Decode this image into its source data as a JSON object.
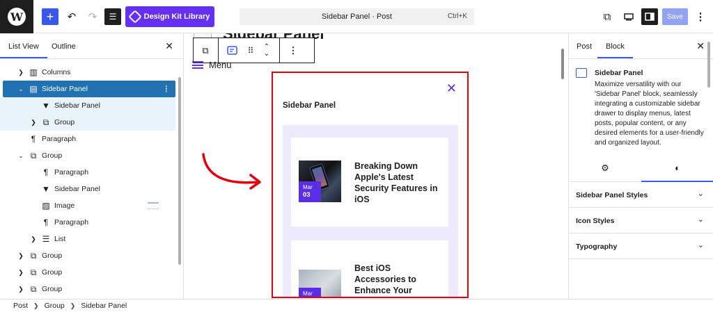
{
  "topbar": {
    "logo_letter": "W",
    "add_icon": "plus-icon",
    "undo_icon": "undo-icon",
    "redo_icon": "redo-icon",
    "document_overview_icon": "list-view-icon",
    "design_kit_label": "Design Kit Library",
    "command_title": "Sidebar Panel · Post",
    "command_shortcut": "Ctrl+K",
    "view_icon": "external-link-icon",
    "preview_icon": "desktop-icon",
    "settings_icon": "sidebar-toggle-icon",
    "save_label": "Save",
    "more_icon": "kebab-icon"
  },
  "left_panel": {
    "tabs": [
      "List View",
      "Outline"
    ],
    "active_tab": "List View",
    "tree": [
      {
        "label": "Columns",
        "icon": "columns-icon",
        "chevron": "›",
        "selected": false
      },
      {
        "label": "Sidebar Panel",
        "icon": "sidebar-panel-icon",
        "chevron": "⌄",
        "selected": true
      },
      {
        "label": "Sidebar Panel",
        "icon": "bookmark-icon",
        "chevron": "",
        "selected": false
      },
      {
        "label": "Group",
        "icon": "group-icon",
        "chevron": "›",
        "selected": false
      },
      {
        "label": "Paragraph",
        "icon": "paragraph-icon",
        "chevron": "",
        "selected": false
      },
      {
        "label": "Group",
        "icon": "group-icon",
        "chevron": "⌄",
        "selected": false
      },
      {
        "label": "Paragraph",
        "icon": "paragraph-icon",
        "chevron": "",
        "selected": false
      },
      {
        "label": "Sidebar Panel",
        "icon": "bookmark-icon",
        "chevron": "",
        "selected": false
      },
      {
        "label": "Image",
        "icon": "image-icon",
        "chevron": "",
        "selected": false
      },
      {
        "label": "Paragraph",
        "icon": "paragraph-icon",
        "chevron": "",
        "selected": false
      },
      {
        "label": "List",
        "icon": "list-icon",
        "chevron": "›",
        "selected": false
      },
      {
        "label": "Group",
        "icon": "group-icon",
        "chevron": "›",
        "selected": false
      },
      {
        "label": "Group",
        "icon": "group-icon",
        "chevron": "›",
        "selected": false
      },
      {
        "label": "Group",
        "icon": "group-icon",
        "chevron": "›",
        "selected": false
      }
    ]
  },
  "canvas": {
    "page_title": "Sidebar Panel",
    "menu_label": "Menu",
    "panel_title": "Sidebar Panel",
    "posts": [
      {
        "title": "Breaking Down Apple's Latest Security Features in iOS",
        "month": "Mar",
        "day": "03"
      },
      {
        "title": "Best iOS Accessories to Enhance Your",
        "month": "Mar",
        "day": ""
      }
    ]
  },
  "right_panel": {
    "tabs": [
      "Post",
      "Block"
    ],
    "active_tab": "Block",
    "block_name": "Sidebar Panel",
    "block_description": "Maximize versatility with our 'Sidebar Panel' block, seamlessly integrating a customizable sidebar drawer to display menus, latest posts, popular content, or any desired elements for a user-friendly and organized layout.",
    "icon_tabs": [
      "settings-icon",
      "styles-icon"
    ],
    "sections": [
      "Sidebar Panel Styles",
      "Icon Styles",
      "Typography"
    ]
  },
  "footer": {
    "breadcrumbs": [
      "Post",
      "Group",
      "Sidebar Panel"
    ]
  },
  "colors": {
    "accent": "#3858e9",
    "brand_purple": "#6530f5",
    "selection": "#2271b1",
    "highlight_frame": "#e3000f",
    "panel_bg": "#efe9fd"
  }
}
